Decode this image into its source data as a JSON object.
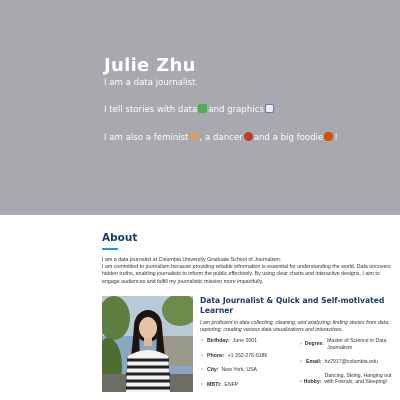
{
  "hero": {
    "name": "Julie Zhu",
    "line1": "I am a data journalist.",
    "line2_a": "I tell stories with data",
    "line2_b": "and graphics",
    "line3_a": "I am also a feminist",
    "line3_b": ", a dancer",
    "line3_c": "and a big foodie",
    "line3_d": "!"
  },
  "about": {
    "title": "About",
    "para1": "I am a data journalist at Columbia University Graduate School of Journalism.",
    "para2": "I am committed to journalism because providing reliable information is essential for understanding the world. Data uncovers hidden truths, enabling journalists to inform the public effectively. By using clear charts and interactive designs, I aim to engage audiences and fulfill my journalistic mission more impactfully."
  },
  "profile": {
    "title": "Data Journalist & Quick and Self-motivated Learner",
    "description": "I am proficient in data collecting, cleaning, and analyzing; finding stories from data; reporting; creating various data visualizations and interactives.",
    "left": [
      {
        "label": "Birthday:",
        "value": "June 2001"
      },
      {
        "label": "Phone:",
        "value": "+1 332-276-9186"
      },
      {
        "label": "City:",
        "value": "New York, USA"
      },
      {
        "label": "MBTI:",
        "value": "ENFP"
      }
    ],
    "right": [
      {
        "label": "Degree:",
        "value": "Master of Science in Data Journalism"
      },
      {
        "label": "Email:",
        "value": "hz2917@columbia.edu"
      },
      {
        "label": "Hobby:",
        "value": "Dancing, Skiing, Hanging out with Friends, and Sleeping!"
      }
    ]
  },
  "icons": {
    "chevron": "›",
    "chart_emoji": "chart-emoji-icon",
    "graph_emoji": "graph-emoji-icon"
  }
}
